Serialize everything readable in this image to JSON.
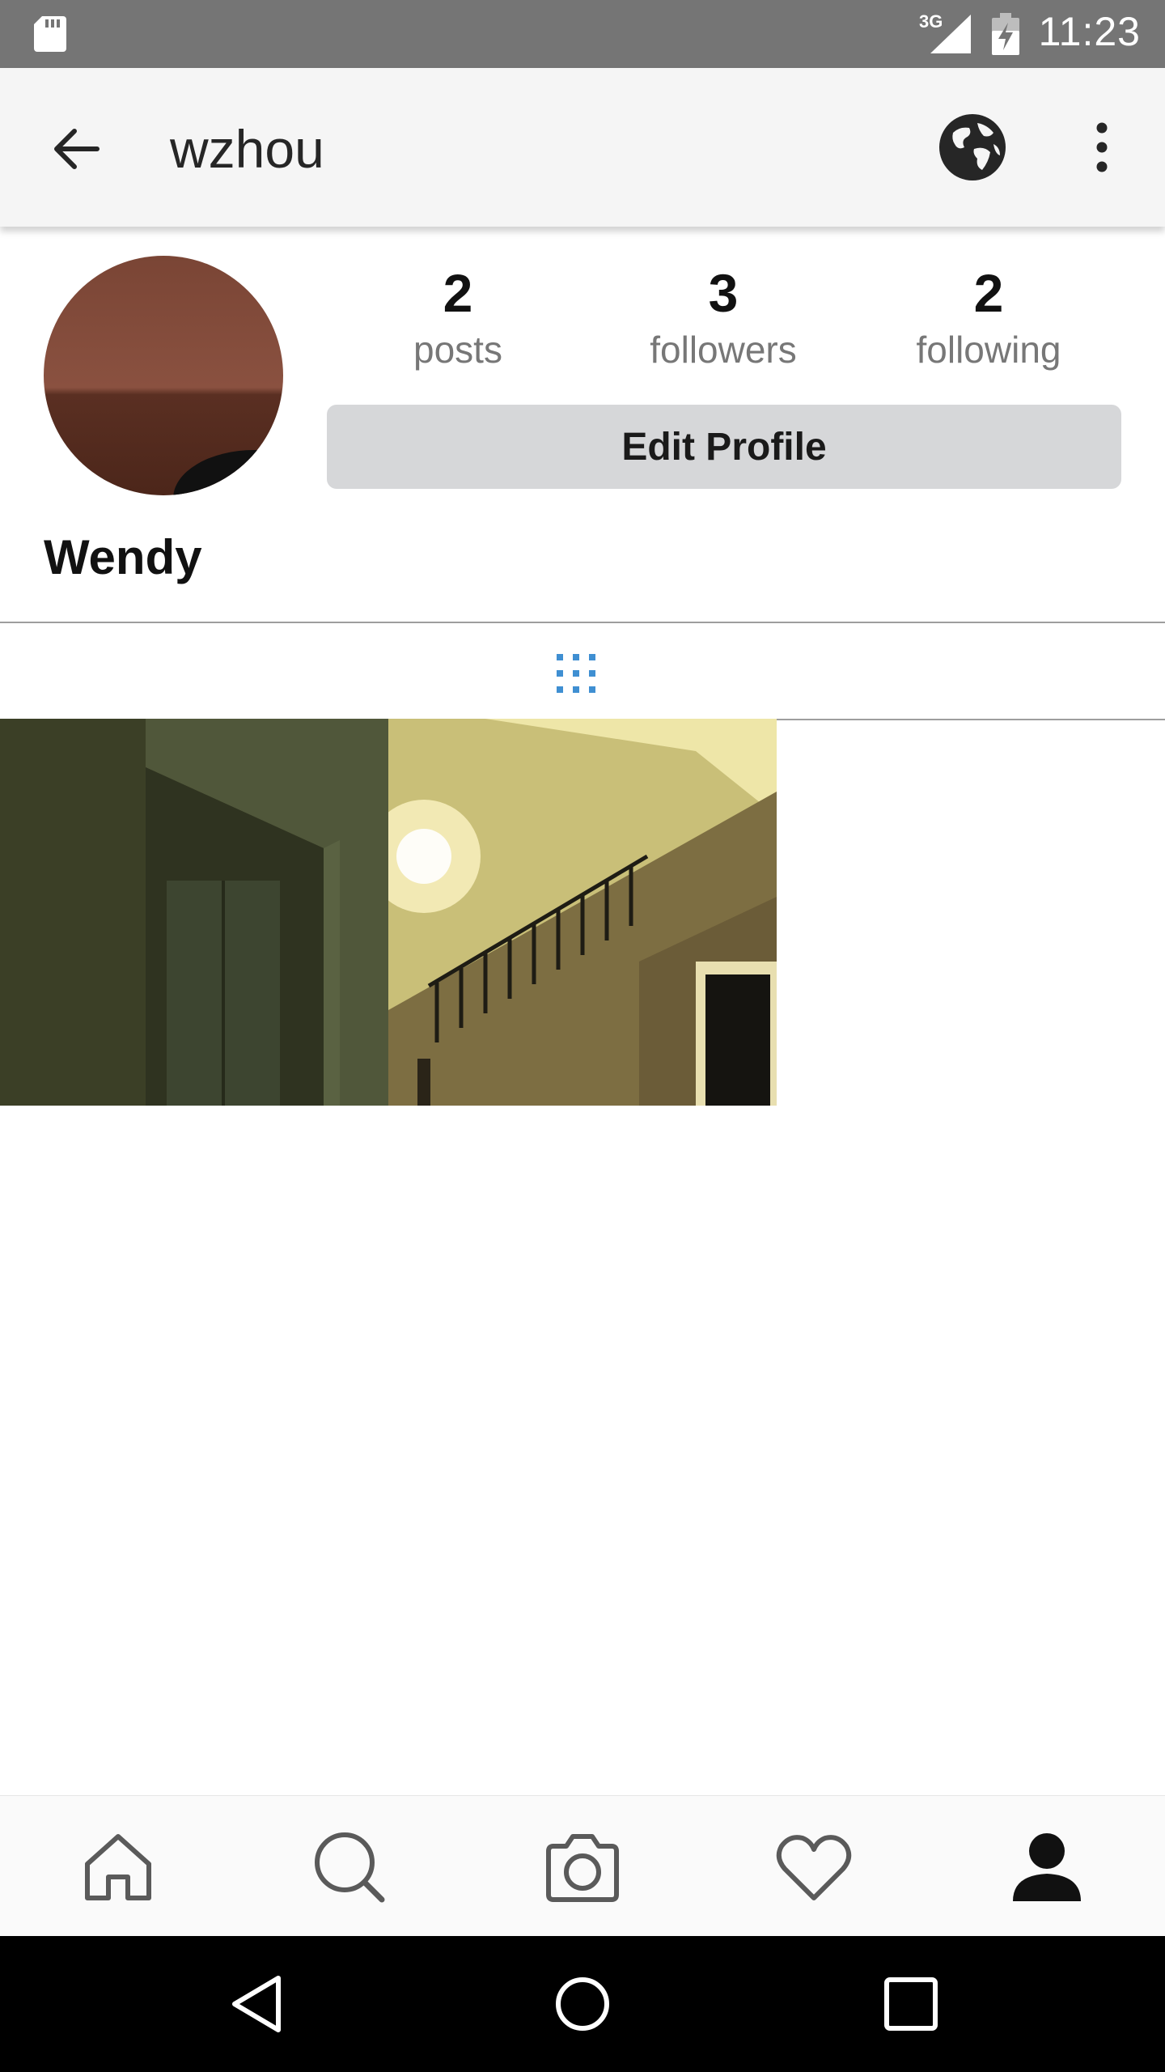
{
  "status_bar": {
    "network": "3G",
    "time": "11:23",
    "icons": [
      "sd-card-icon",
      "cell-signal-icon",
      "battery-charging-icon"
    ]
  },
  "header": {
    "title": "wzhou",
    "icons": [
      "back-arrow-icon",
      "globe-icon",
      "more-vertical-icon"
    ]
  },
  "profile": {
    "display_name": "Wendy",
    "stats": [
      {
        "value": "2",
        "label": "posts"
      },
      {
        "value": "3",
        "label": "followers"
      },
      {
        "value": "2",
        "label": "following"
      }
    ],
    "edit_button_label": "Edit Profile"
  },
  "tabs": {
    "active": "grid",
    "icons": [
      "grid-view-icon"
    ],
    "accent_color": "#3f8fd2"
  },
  "posts": [
    {
      "name": "post-photo-1",
      "depicts": "dark room with closet doors"
    },
    {
      "name": "post-photo-2",
      "depicts": "lit staircase with railing"
    }
  ],
  "bottom_nav": {
    "items": [
      "home",
      "search",
      "camera",
      "activity",
      "profile"
    ],
    "active": "profile"
  },
  "system_nav": {
    "icons": [
      "nav-back-icon",
      "nav-home-icon",
      "nav-recents-icon"
    ]
  }
}
